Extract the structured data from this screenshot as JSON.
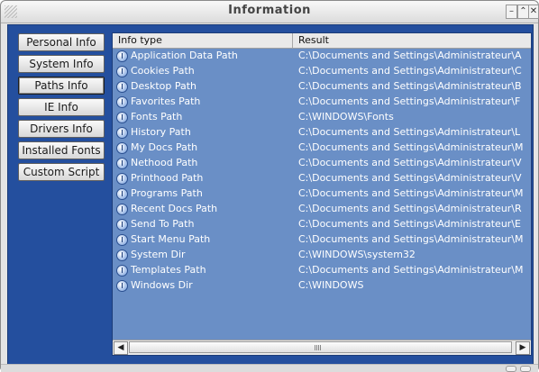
{
  "window": {
    "title": "Information"
  },
  "nav": [
    {
      "id": "personal-info",
      "label": "Personal Info",
      "active": false
    },
    {
      "id": "system-info",
      "label": "System Info",
      "active": false
    },
    {
      "id": "paths-info",
      "label": "Paths Info",
      "active": true
    },
    {
      "id": "ie-info",
      "label": "IE Info",
      "active": false
    },
    {
      "id": "drivers-info",
      "label": "Drivers Info",
      "active": false
    },
    {
      "id": "installed-fonts",
      "label": "Installed Fonts",
      "active": false
    },
    {
      "id": "custom-script",
      "label": "Custom Script",
      "active": false
    }
  ],
  "list": {
    "columns": {
      "type": "Info type",
      "result": "Result"
    },
    "rows": [
      {
        "name": "Application Data Path",
        "value": "C:\\Documents and Settings\\Administrateur\\A"
      },
      {
        "name": "Cookies Path",
        "value": "C:\\Documents and Settings\\Administrateur\\C"
      },
      {
        "name": "Desktop Path",
        "value": "C:\\Documents and Settings\\Administrateur\\B"
      },
      {
        "name": "Favorites Path",
        "value": "C:\\Documents and Settings\\Administrateur\\F"
      },
      {
        "name": "Fonts Path",
        "value": "C:\\WINDOWS\\Fonts"
      },
      {
        "name": "History Path",
        "value": "C:\\Documents and Settings\\Administrateur\\L"
      },
      {
        "name": "My Docs Path",
        "value": "C:\\Documents and Settings\\Administrateur\\M"
      },
      {
        "name": "Nethood Path",
        "value": "C:\\Documents and Settings\\Administrateur\\V"
      },
      {
        "name": "Printhood Path",
        "value": "C:\\Documents and Settings\\Administrateur\\V"
      },
      {
        "name": "Programs Path",
        "value": "C:\\Documents and Settings\\Administrateur\\M"
      },
      {
        "name": "Recent Docs Path",
        "value": "C:\\Documents and Settings\\Administrateur\\R"
      },
      {
        "name": "Send To Path",
        "value": "C:\\Documents and Settings\\Administrateur\\E"
      },
      {
        "name": "Start Menu Path",
        "value": "C:\\Documents and Settings\\Administrateur\\M"
      },
      {
        "name": "System Dir",
        "value": "C:\\WINDOWS\\system32"
      },
      {
        "name": "Templates Path",
        "value": "C:\\Documents and Settings\\Administrateur\\M"
      },
      {
        "name": "Windows Dir",
        "value": "C:\\WINDOWS"
      }
    ]
  },
  "icons": {
    "row": "info-icon",
    "close": "close-icon"
  },
  "colors": {
    "client_bg": "#244f9e",
    "list_bg": "#6a8fc6",
    "row_text": "#ffffff"
  }
}
